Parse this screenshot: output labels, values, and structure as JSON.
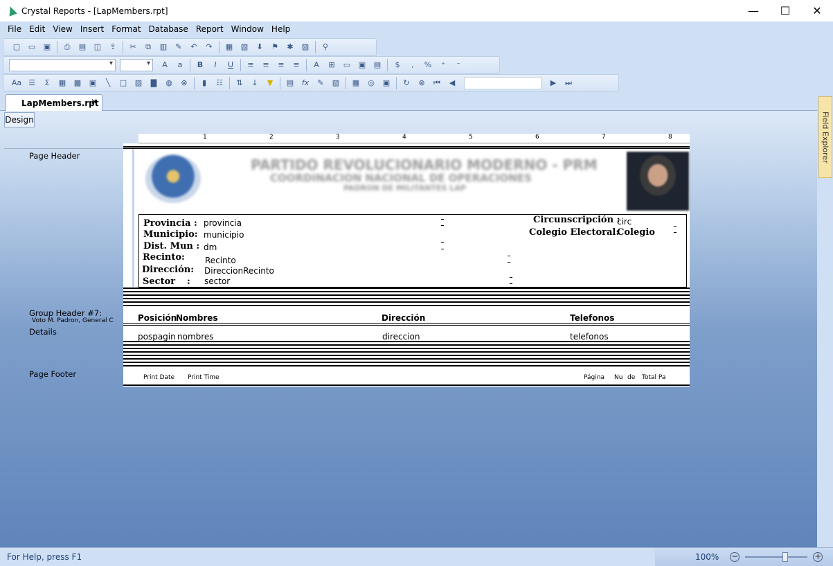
{
  "window": {
    "title": "Crystal Reports - [LapMembers.rpt]",
    "minimize": "—",
    "maximize": "☐",
    "close": "✕"
  },
  "menu": [
    "File",
    "Edit",
    "View",
    "Insert",
    "Format",
    "Database",
    "Report",
    "Window",
    "Help"
  ],
  "document_tab": {
    "label": "LapMembers.rpt",
    "close": "✕"
  },
  "design_tab": "Design",
  "sections": {
    "page_header": "Page Header",
    "group_header": "Group Header #7:",
    "group_header_sub": "Voto M. Padron, General C",
    "details": "Details",
    "page_footer": "Page Footer"
  },
  "ruler_marks": [
    "1",
    "2",
    "3",
    "4",
    "5",
    "6",
    "7",
    "8"
  ],
  "report_header": {
    "title_line1": "PARTIDO REVOLUCIONARIO MODERNO - PRM",
    "title_line2": "COORDINACION NACIONAL DE OPERACIONES",
    "title_line3": "PADRON DE MILITANTES LAP"
  },
  "labels": {
    "provincia": "Provincia :",
    "municipio": "Municipio:",
    "dist_mun": "Dist. Mun :",
    "recinto": "Recinto:",
    "direccion": "Dirección:",
    "sector": "Sector",
    "sector_colon": ":",
    "circunscripcion": "Circunscripción :",
    "colegio_electoral": "Colegio Electoral:"
  },
  "fields": {
    "provincia": "provincia",
    "municipio": "municipio",
    "dm": "dm",
    "recinto": "Recinto",
    "direccion_recinto": "DireccionRecinto",
    "sector": "sector",
    "circ": "circ",
    "colegio": "Colegio"
  },
  "group_columns": {
    "posicion": "Posición",
    "nombres": "Nombres",
    "direccion": "Dirección",
    "telefonos": "Telefonos"
  },
  "detail_fields": {
    "pospagina": "pospagina",
    "nombres": "nombres",
    "direccion": "direccion",
    "telefonos": "telefonos"
  },
  "footer_fields": {
    "print_date": "Print Date",
    "print_time": "Print Time",
    "pagina": "Página",
    "num": "Nu",
    "de": "de",
    "total": "Total Pa"
  },
  "field_explorer": "Field Explorer",
  "status": {
    "help": "For Help, press F1",
    "zoom": "100%",
    "zoom_out": "−",
    "zoom_in": "+"
  }
}
